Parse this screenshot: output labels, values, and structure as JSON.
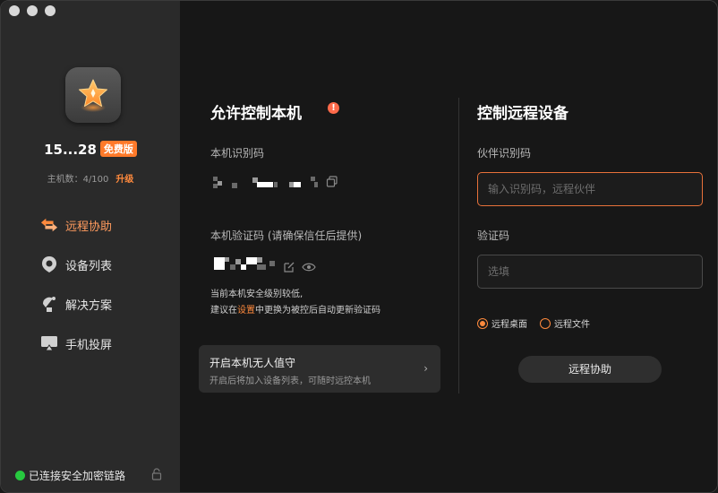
{
  "sidebar": {
    "user_id": "15...28",
    "plan_badge": "免费版",
    "host_count_label": "主机数：4/100",
    "upgrade_label": "升级",
    "nav": [
      {
        "label": "远程协助",
        "icon": "remote-assist-icon",
        "active": true
      },
      {
        "label": "设备列表",
        "icon": "device-list-icon",
        "active": false
      },
      {
        "label": "解决方案",
        "icon": "solution-icon",
        "active": false
      },
      {
        "label": "手机投屏",
        "icon": "screen-cast-icon",
        "active": false
      }
    ],
    "status_text": "已连接安全加密链路"
  },
  "allow": {
    "title": "允许控制本机",
    "device_code_label": "本机识别码",
    "verify_code_label": "本机验证码 (请确保信任后提供)",
    "hint_line1": "当前本机安全级别较低,",
    "hint_prefix": "建议在",
    "hint_link": "设置",
    "hint_suffix": "中更换为被控后自动更新验证码",
    "unattended_title": "开启本机无人值守",
    "unattended_desc": "开启后将加入设备列表，可随时远控本机"
  },
  "control": {
    "title": "控制远程设备",
    "partner_label": "伙伴识别码",
    "partner_placeholder": "输入识别码，远程伙伴",
    "verify_label": "验证码",
    "verify_placeholder": "选填",
    "option_desktop": "远程桌面",
    "option_file": "远程文件",
    "selected_option": "远程桌面",
    "submit_label": "远程协助"
  },
  "colors": {
    "accent": "#ff8a3d",
    "status_green": "#27c93f",
    "warning": "#ff6a4a"
  }
}
